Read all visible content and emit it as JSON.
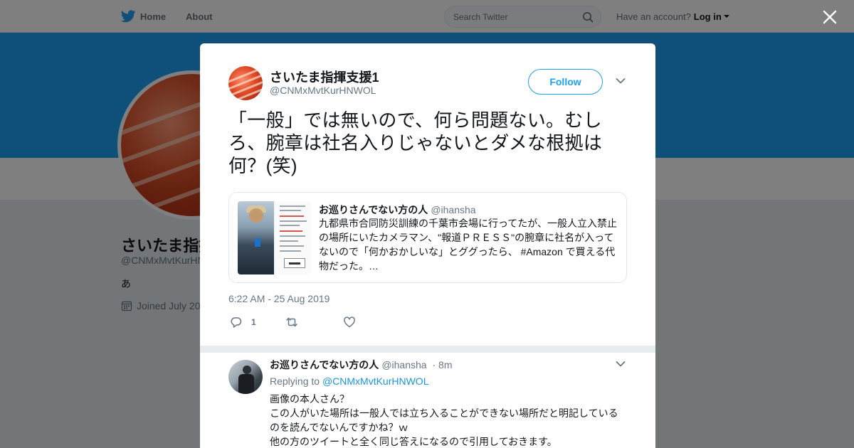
{
  "nav": {
    "home_label": "Home",
    "about_label": "About",
    "search_placeholder": "Search Twitter",
    "have_account": "Have an account?",
    "login_label": "Log in"
  },
  "profile": {
    "name": "さいたま指揮",
    "handle": "@CNMxMvtKurHN",
    "bio": "あ",
    "joined": "Joined July 20"
  },
  "tweet": {
    "name": "さいたま指揮支援1",
    "handle": "@CNMxMvtKurHNWOL",
    "follow_label": "Follow",
    "text": "「一般」では無いので、何ら問題ない。むしろ、腕章は社名入りじゃないとダメな根拠は何？(笑)",
    "timestamp": "6:22 AM - 25 Aug 2019",
    "reply_count": "1",
    "quoted": {
      "name": "お巡りさんでない方の人",
      "handle": "@ihansha",
      "text": "九都県市合同防災訓練の千葉市会場に行ってたが、一般人立入禁止の場所にいたカメラマン、\"報道ＰＲＥＳＳ\"の腕章に社名が入ってないので「何かおかしいな」とググったら、 #Amazon で買える代物だった。…"
    }
  },
  "reply": {
    "name": "お巡りさんでない方の人",
    "handle": "@ihansha",
    "separator": "·",
    "time": "8m",
    "replying_prefix": "Replying to",
    "replying_to": "@CNMxMvtKurHNWOL",
    "lines": [
      "画像の本人さん？",
      "この人がいた場所は一般人では立ち入ることができない場所だと明記しているのを読んでないんですかね？ｗ",
      "他の方のツイートと全く同じ答えになるので引用しておきます。"
    ]
  },
  "colors": {
    "brand_blue": "#1da1f2",
    "link_blue": "#1b95e0",
    "secondary_text": "#657786"
  }
}
